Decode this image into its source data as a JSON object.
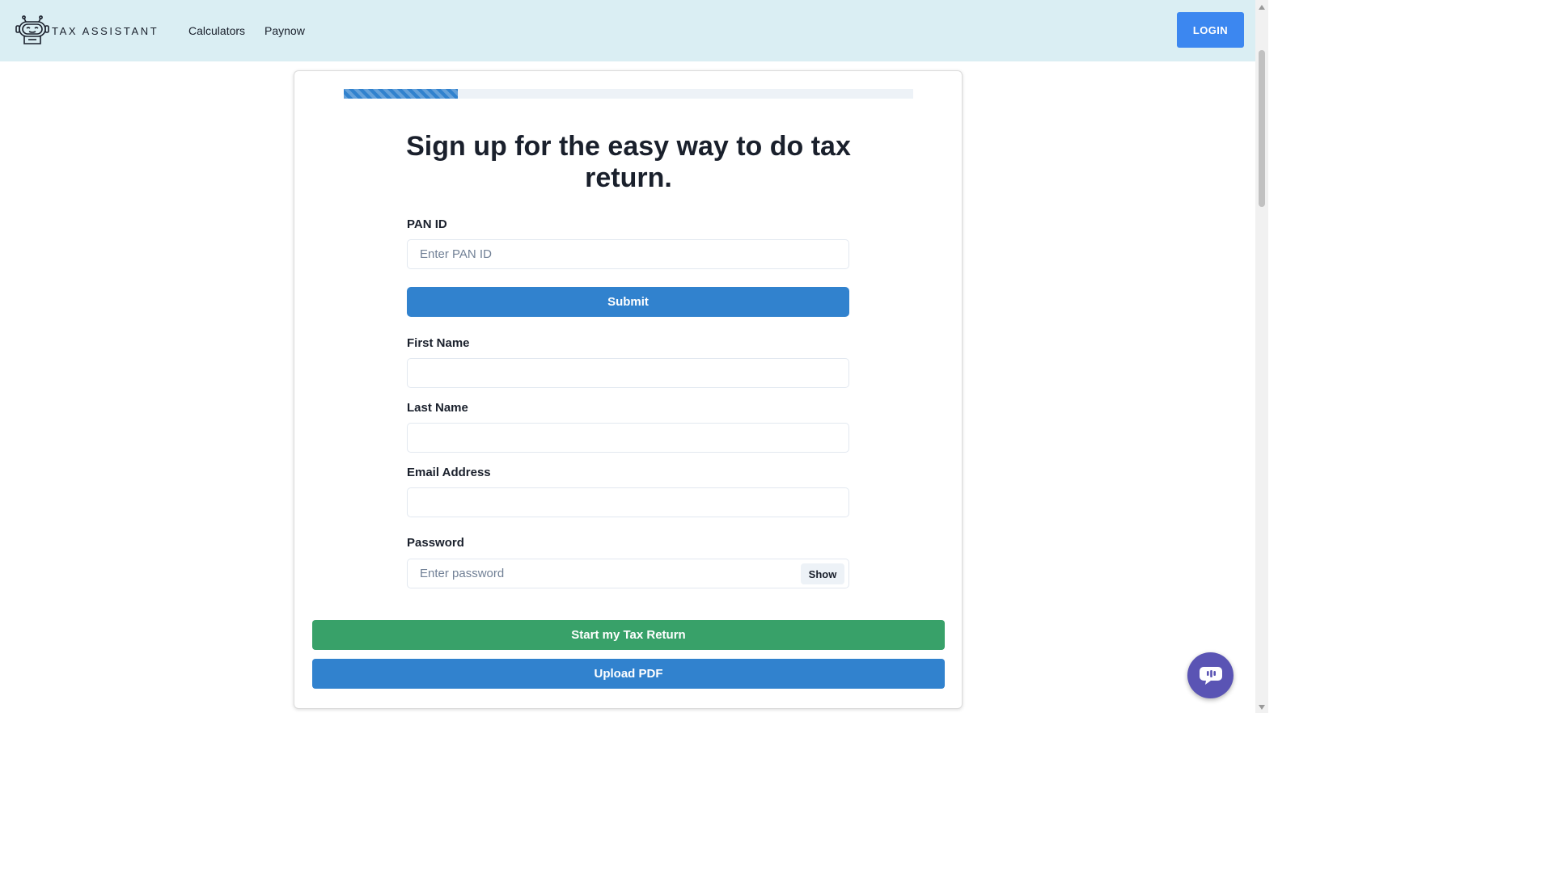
{
  "header": {
    "brand": "TAX ASSISTANT",
    "nav": [
      {
        "label": "Calculators"
      },
      {
        "label": "Paynow"
      }
    ],
    "login_label": "LOGIN"
  },
  "signup": {
    "progress_percent": 20,
    "headline": "Sign up for the easy way to do tax return.",
    "pan": {
      "label": "PAN ID",
      "placeholder": "Enter PAN ID",
      "value": ""
    },
    "submit_label": "Submit",
    "first_name": {
      "label": "First Name",
      "value": ""
    },
    "last_name": {
      "label": "Last Name",
      "value": ""
    },
    "email": {
      "label": "Email Address",
      "value": ""
    },
    "password": {
      "label": "Password",
      "placeholder": "Enter password",
      "show_label": "Show"
    },
    "start_label": "Start my Tax Return",
    "upload_label": "Upload PDF"
  },
  "colors": {
    "header_bg": "#daeef3",
    "primary": "#3182ce",
    "login": "#3c87f0",
    "success": "#38a169",
    "chat": "#5a54b4"
  },
  "icons": {
    "logo": "robot-icon",
    "chat": "chat-bubble-icon"
  }
}
